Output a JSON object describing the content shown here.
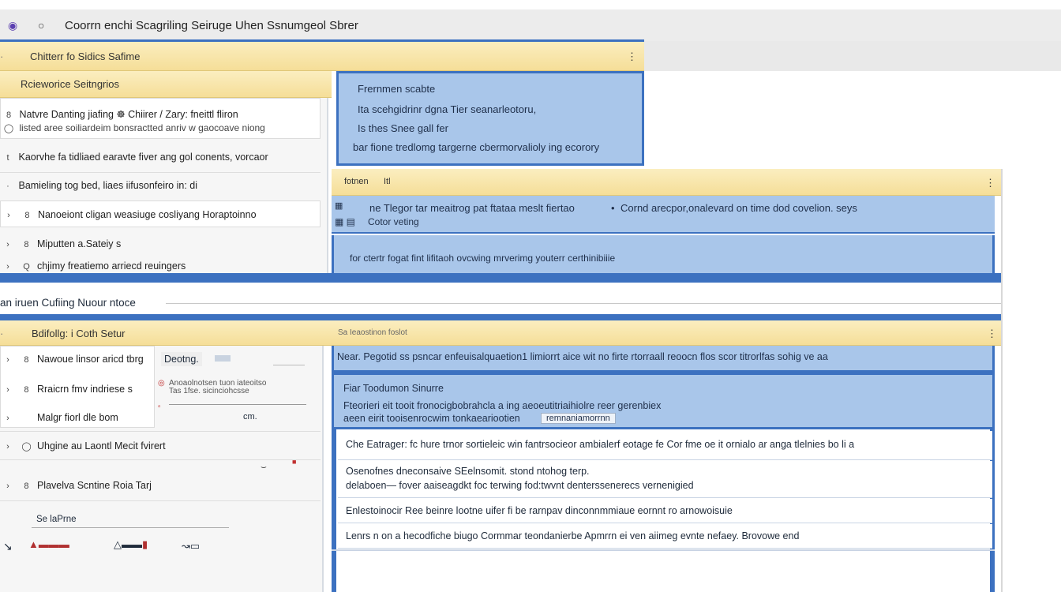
{
  "window": {
    "title": "Coorrn enchi Scagriling Seiruge Uhen Ssnumgeol Sbrer"
  },
  "top_section": {
    "header": "Chitterr fo Sidics Safime",
    "sub_header": "Rcieworice Seitngrios",
    "items": [
      {
        "label": "Natvre Danting jiafing  ☸  Chiirer / Zary: fneittl fliron",
        "sub": "listed aree soiliardeim bonsractted anriv w gaocoave niong"
      },
      {
        "label": "Kaorvhe fa tidliaed earavte fiver ang gol conents,  vorcaor"
      },
      {
        "label": "Bamieling tog bed, liaes iifusonfeiro in: di"
      },
      {
        "label": "Nanoeiont cligan weasiuge cosliyang  Horaptoinno"
      },
      {
        "label": "Miputten a.Sateiy s"
      },
      {
        "label": "chjimy freatiemo arriecd reuingers"
      }
    ],
    "info_panel": [
      "Frernmen scabte",
      "Ita scehgidrinr dgna  Tier seanarleotoru,",
      "Is thes Snee gall fer",
      "bar fione tredlomg targerne cbermorvalioly ing ecorory"
    ],
    "mid": {
      "header_left": "fotnen",
      "header_mid": "Itl",
      "row1_a": "ne Tlegor tar meaitrog pat ftataa meslt fiertao",
      "row1_b": "Cornd arecpor,onalevard on time dod covelion. seys",
      "row1_c": "Cotor veting",
      "row2": "for ctertr fogat fint lifitaoh ovcwing mrverimg youterr certhinibiiie"
    }
  },
  "divider_label": "an iruen  Cufiing Nuour ntoce",
  "bottom_section": {
    "header": "Bdifollg: i  Coth Setur",
    "header_right": "Sa Ieaostinon foslot",
    "items": [
      {
        "label": "Nawoue linsor aricd tbrg",
        "badge": "Deotng."
      },
      {
        "label": "Rraicrn fmv indriese s",
        "side1": "Anoaolnotsen tuon iateoitso ",
        "side2": "Tas 1fse. sicinciohcsse"
      },
      {
        "label": "Malgr fiorl dle bom",
        "note": "cm."
      },
      {
        "label": "Uhgine au Laontl Mecit fvirert"
      },
      {
        "label": "Plavelva Scntine Roia Tarj"
      }
    ],
    "footer_label": "Se laPrne",
    "info": {
      "row1": "Near. Pegotid ss psncar enfeuisalquaetion1 limiorrt aice wit no firte rtorraall reoocn flos scor titrorlfas sohig ve aa",
      "row2_title": "Fiar Toodumon Sinurre",
      "row2_line1": "Fteorieri eit tooit fronocigbobrahcla a ing aeoeutitriaihiolre reer gerenbiex",
      "row2_line2": "aeen eirit tooisenrocwim tonkaeariootien",
      "row2_chip": "remnaniamorrnn",
      "rows": [
        "Che Eatrager: fc hure trnor sortieleic win fantrsocieor ambialerf eotage fe Cor fme oe it ornialo ar anga tlelnies bo li a",
        "Osenofnes dneconsaive SEelnsomit.  stond ntohog terp.",
        "delaboen— fover aaiseagdkt foc terwing fod:twvnt denterssenerecs vernenigied",
        "Enlestoinocir Ree beinre lootne uifer fi be rarnpav dinconnmmiaue eornnt ro arnowoisuie",
        "Lenrs  n on a hecodfiche biugo  Cormmar  teondanierbe Apmrrn ei ven aiimeg evnte nefaey.  Brovowe end"
      ]
    }
  },
  "colors": {
    "accent_blue": "#3c71c0",
    "panel_blue": "#a9c6ea",
    "header_yellow": "#f5de98"
  }
}
